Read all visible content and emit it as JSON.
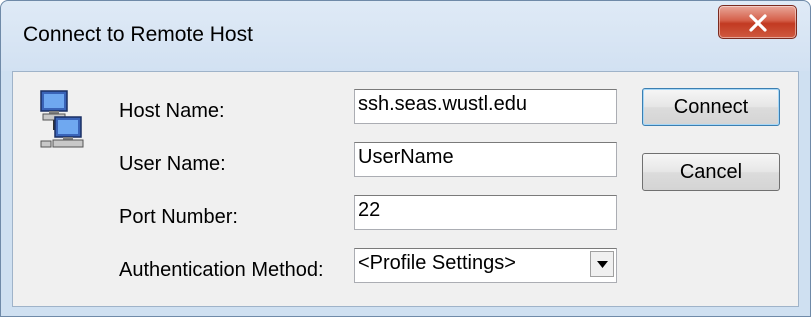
{
  "window": {
    "title": "Connect to Remote Host"
  },
  "form": {
    "host_label": "Host Name:",
    "host_value": "ssh.seas.wustl.edu",
    "user_label": "User Name:",
    "user_value": "UserName",
    "port_label": "Port Number:",
    "port_value": "22",
    "auth_label": "Authentication Method:",
    "auth_value": "<Profile Settings>"
  },
  "buttons": {
    "connect": "Connect",
    "cancel": "Cancel"
  },
  "icons": {
    "close": "close-icon",
    "host": "network-computers-icon",
    "dropdown": "chevron-down-icon"
  },
  "colors": {
    "close_button": "#c23a22",
    "titlebar": "#d2e1f2",
    "client_bg": "#f0f0f0"
  }
}
